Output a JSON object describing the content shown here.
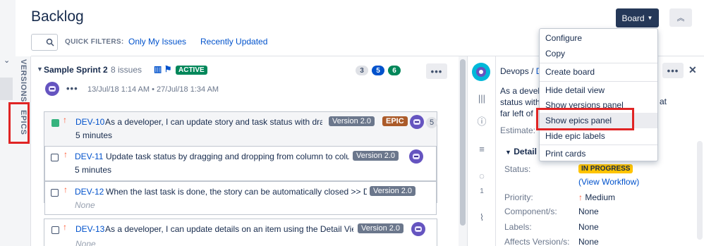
{
  "header": {
    "title": "Backlog",
    "quick_filters_label": "QUICK FILTERS:",
    "filters": [
      "Only My Issues",
      "Recently Updated"
    ],
    "board_button": "Board"
  },
  "side_tabs": {
    "versions": "VERSIONS",
    "epics": "EPICS"
  },
  "sprint": {
    "name": "Sample Sprint 2",
    "count": "8 issues",
    "status": "ACTIVE",
    "pills": [
      "3",
      "5",
      "6"
    ],
    "more": "•••",
    "dates": "13/Jul/18 1:14 AM • 27/Jul/18 1:34 AM"
  },
  "issues": [
    {
      "key": "DEV-10",
      "summary": "As a developer, I can update story and task status with drag",
      "line2": "5 minutes",
      "version": "Version 2.0",
      "epic": "EPIC",
      "estimate": "5"
    },
    {
      "key": "DEV-11",
      "summary": "Update task status by dragging and dropping from column to colur",
      "line2": "5 minutes",
      "version": "Version 2.0"
    },
    {
      "key": "DEV-12",
      "summary": "When the last task is done, the story can be automatically closed >> Dra",
      "line2": "None",
      "version": "Version 2.0"
    },
    {
      "key": "DEV-13",
      "summary": "As a developer, I can update details on an item using the Detail View",
      "line2": "None",
      "version": "Version 2.0"
    }
  ],
  "detail": {
    "crumb_project": "Devops /",
    "crumb_key": "D",
    "desc_lines": [
      "As a develo",
      "status with",
      "far left of"
    ],
    "desc_tail": "at",
    "estimate_label": "Estimate:",
    "comment_count": "1",
    "section": "Detail",
    "fields": [
      {
        "label": "Status:",
        "value": "IN PROGRESS"
      },
      {
        "label": "Priority:",
        "value": "Medium"
      },
      {
        "label": "Component/s:",
        "value": "None"
      },
      {
        "label": "Labels:",
        "value": "None"
      },
      {
        "label": "Affects Version/s:",
        "value": "None"
      }
    ],
    "view_workflow": "(View Workflow)"
  },
  "menu": {
    "items": [
      "Configure",
      "Copy",
      "Create board",
      "Hide detail view",
      "Show versions panel",
      "Show epics panel",
      "Hide epic labels",
      "Print cards"
    ],
    "highlighted": "Show epics panel"
  },
  "colors": {
    "accent": "#0052cc",
    "annotation": "#e02424",
    "active": "#00875a",
    "board_btn": "#253858"
  }
}
